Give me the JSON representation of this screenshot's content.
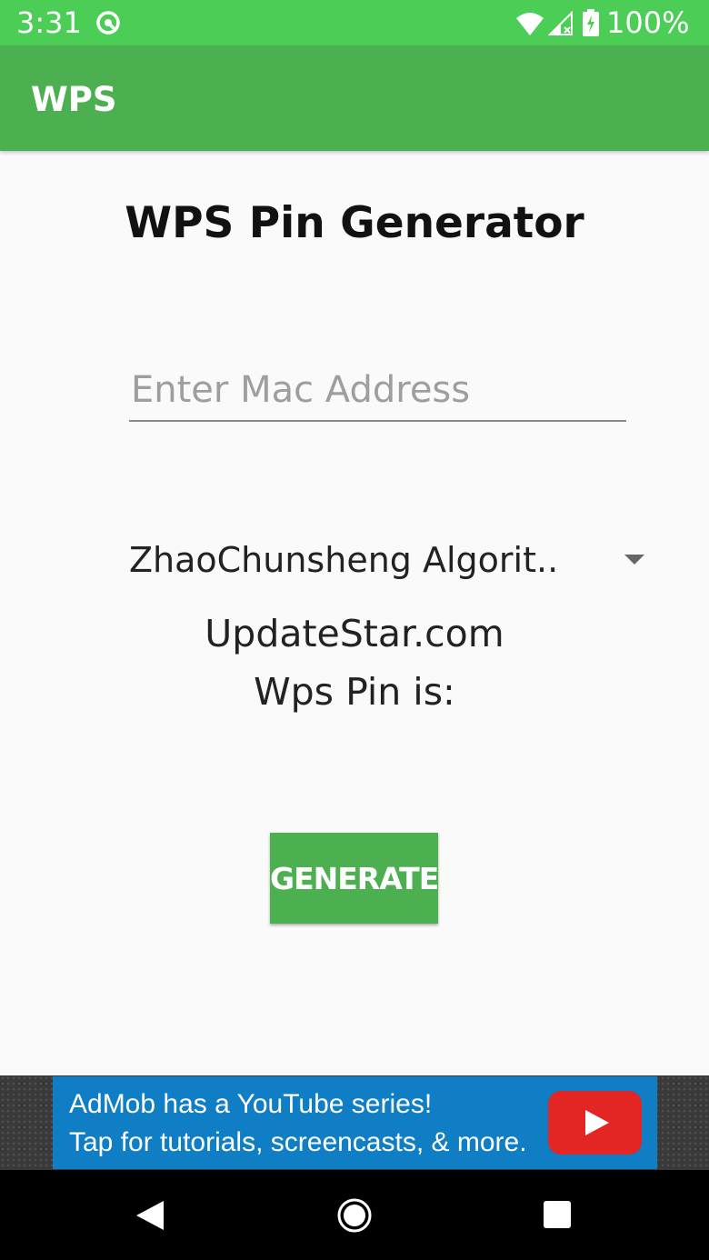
{
  "status_bar": {
    "time": "3:31",
    "battery": "100%",
    "icons": [
      "sync-icon",
      "wifi-icon",
      "signal-icon",
      "battery-icon"
    ]
  },
  "app_bar": {
    "title": "WPS"
  },
  "main": {
    "title": "WPS Pin Generator",
    "mac_input_placeholder": "Enter Mac Address",
    "mac_input_value": "",
    "algorithm_selected": "ZhaoChunsheng Algorit..",
    "site_text": "UpdateStar.com",
    "pin_label": "Wps Pin is:",
    "generate_label": "GENERATE"
  },
  "ad": {
    "line1": "AdMob has a YouTube series!",
    "line2": "Tap for tutorials, screencasts, & more."
  },
  "nav_bar": {
    "icons": [
      "back-icon",
      "home-icon",
      "recents-icon"
    ]
  },
  "colors": {
    "status_bar": "#4ccd55",
    "app_bar": "#4caf50",
    "button": "#4caf50",
    "ad_background": "#0f7ec4",
    "youtube_red": "#e32524"
  }
}
